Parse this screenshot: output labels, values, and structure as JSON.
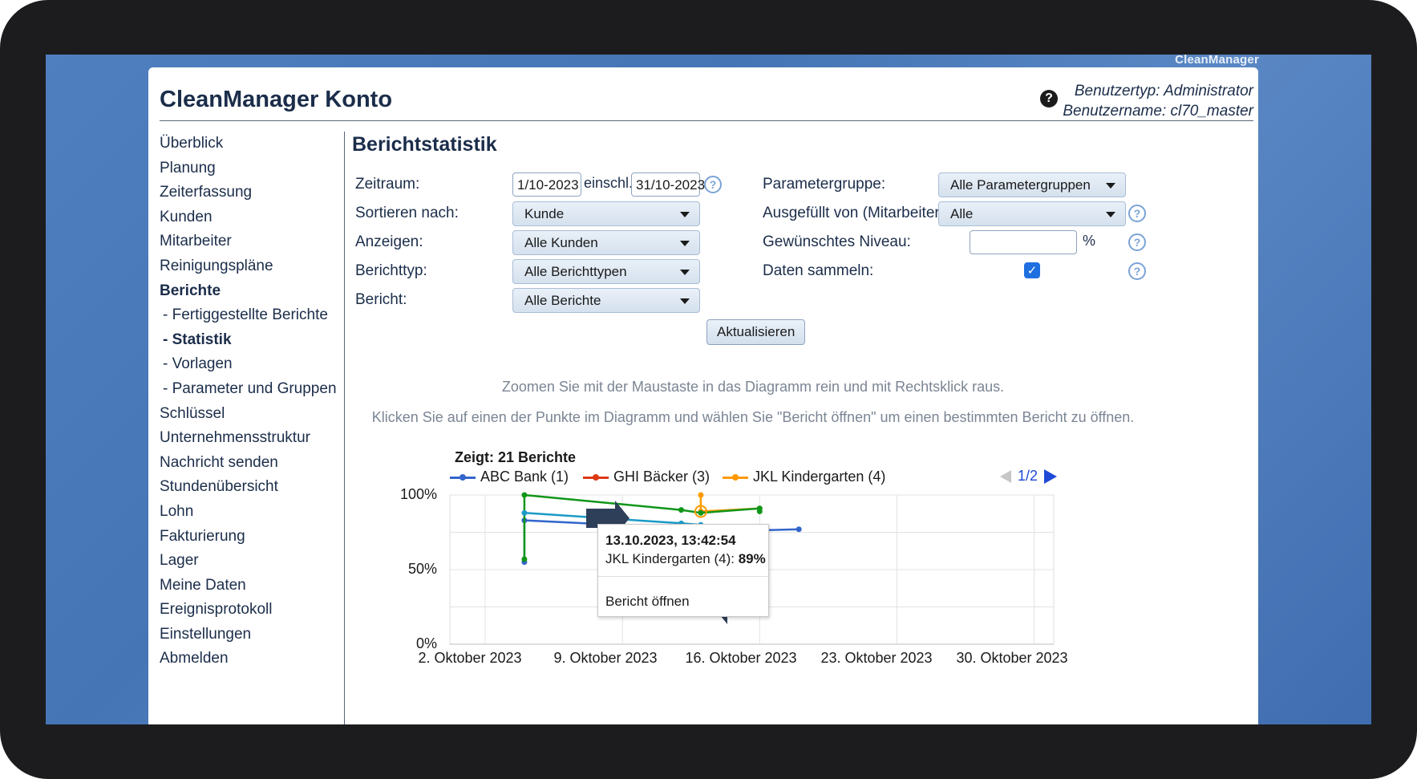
{
  "brand": "CleanManager",
  "header": {
    "title": "CleanManager Konto",
    "user_type": "Benutzertyp: Administrator",
    "user_name": "Benutzername: cl70_master"
  },
  "sidebar": {
    "items": [
      {
        "label": "Überblick"
      },
      {
        "label": "Planung"
      },
      {
        "label": "Zeiterfassung"
      },
      {
        "label": "Kunden"
      },
      {
        "label": "Mitarbeiter"
      },
      {
        "label": "Reinigungspläne"
      },
      {
        "label": "Berichte",
        "active": true
      },
      {
        "label": "- Fertiggestellte Berichte"
      },
      {
        "label": "- Statistik",
        "active": true
      },
      {
        "label": "- Vorlagen"
      },
      {
        "label": "- Parameter und Gruppen"
      },
      {
        "label": "Schlüssel"
      },
      {
        "label": "Unternehmensstruktur"
      },
      {
        "label": "Nachricht senden"
      },
      {
        "label": "Stundenübersicht"
      },
      {
        "label": "Lohn"
      },
      {
        "label": "Fakturierung"
      },
      {
        "label": "Lager"
      },
      {
        "label": "Meine Daten"
      },
      {
        "label": "Ereignisprotokoll"
      },
      {
        "label": "Einstellungen"
      },
      {
        "label": "Abmelden"
      }
    ]
  },
  "page": {
    "title": "Berichtstatistik"
  },
  "form": {
    "zeitraum": {
      "label": "Zeitraum:",
      "from": "1/10-2023",
      "sep": "einschl.",
      "to": "31/10-2023"
    },
    "sortieren": {
      "label": "Sortieren nach:",
      "value": "Kunde"
    },
    "anzeigen": {
      "label": "Anzeigen:",
      "value": "Alle Kunden"
    },
    "berichttyp": {
      "label": "Berichttyp:",
      "value": "Alle Berichttypen"
    },
    "bericht": {
      "label": "Bericht:",
      "value": "Alle Berichte"
    },
    "parametergruppe": {
      "label": "Parametergruppe:",
      "value": "Alle Parametergruppen"
    },
    "ausgefuellt": {
      "label": "Ausgefüllt von (Mitarbeiter):",
      "value": "Alle"
    },
    "niveau": {
      "label": "Gewünschtes Niveau:",
      "value": "",
      "unit": "%"
    },
    "daten_sammeln": {
      "label": "Daten sammeln:",
      "checked": true
    },
    "help_glyph": "?",
    "update_button": "Aktualisieren"
  },
  "hints": {
    "zoom": "Zoomen Sie mit der Maustaste in das Diagramm rein und mit Rechtsklick raus.",
    "click": "Klicken Sie auf einen der Punkte im Diagramm und wählen Sie \"Bericht öffnen\" um einen bestimmten Bericht zu öffnen."
  },
  "chart_data": {
    "type": "line",
    "count_label": "Zeigt: 21 Berichte",
    "pager": "1/2",
    "xlim": [
      "2023-10-01",
      "2023-10-31"
    ],
    "ylim": [
      0,
      100
    ],
    "x_ticks": [
      "2. Oktober 2023",
      "9. Oktober 2023",
      "16. Oktober 2023",
      "23. Oktober 2023",
      "30. Oktober 2023"
    ],
    "y_ticks": [
      "100%",
      "50%",
      "0%"
    ],
    "grid": true,
    "legend_position": "top",
    "series": [
      {
        "name": "ABC Bank (1)",
        "color": "#3366cc",
        "points": [
          [
            "2023-10-04",
            55
          ],
          [
            "2023-10-04",
            83
          ],
          [
            "2023-10-15",
            76
          ],
          [
            "2023-10-18",
            77
          ]
        ]
      },
      {
        "name": "GHI Bäcker (3)",
        "color": "#dc3912",
        "points": []
      },
      {
        "name": "JKL Kindergarten (4)",
        "color": "#ff9900",
        "points": [
          [
            "2023-10-13",
            100
          ],
          [
            "2023-10-13",
            89
          ],
          [
            "2023-10-16",
            91
          ]
        ]
      },
      {
        "name": "",
        "color": "#109618",
        "points": [
          [
            "2023-10-04",
            57
          ],
          [
            "2023-10-04",
            100
          ],
          [
            "2023-10-12",
            90
          ],
          [
            "2023-10-13",
            88
          ],
          [
            "2023-10-16",
            91
          ],
          [
            "2023-10-16",
            89
          ]
        ]
      },
      {
        "name": "",
        "color": "#1a9ac7",
        "points": [
          [
            "2023-10-04",
            88
          ],
          [
            "2023-10-12",
            81
          ],
          [
            "2023-10-13",
            80
          ]
        ]
      }
    ],
    "tooltip": {
      "date": "13.10.2023, 13:42:54",
      "series": "JKL Kindergarten (4):",
      "value": "89%",
      "action": "Bericht öffnen"
    }
  }
}
